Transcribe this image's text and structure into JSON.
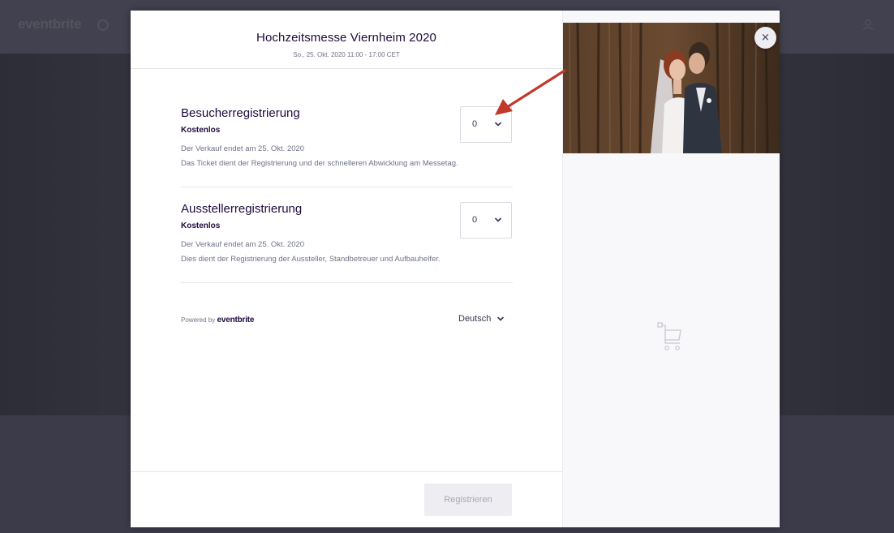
{
  "background": {
    "logo": "eventbrite"
  },
  "modal": {
    "title": "Hochzeitsmesse Viernheim 2020",
    "date": "So., 25. Okt. 2020 11:00 - 17:00 CET",
    "tickets": [
      {
        "name": "Besucherregistrierung",
        "price": "Kostenlos",
        "sale_end": "Der Verkauf endet am 25. Okt. 2020",
        "description": "Das Ticket dient der Registrierung und der schnelleren Abwicklung am Messetag.",
        "quantity": "0"
      },
      {
        "name": "Ausstellerregistrierung",
        "price": "Kostenlos",
        "sale_end": "Der Verkauf endet am 25. Okt. 2020",
        "description": "Dies dient der Registrierung der Aussteller, Standbetreuer und Aufbauhelfer.",
        "quantity": "0"
      }
    ],
    "powered_prefix": "Powered by",
    "powered_brand": "eventbrite",
    "language": "Deutsch",
    "register_label": "Registrieren",
    "close_label": "×"
  },
  "colors": {
    "annotation_arrow": "#c0392b",
    "overlay": "#3a3a48"
  }
}
